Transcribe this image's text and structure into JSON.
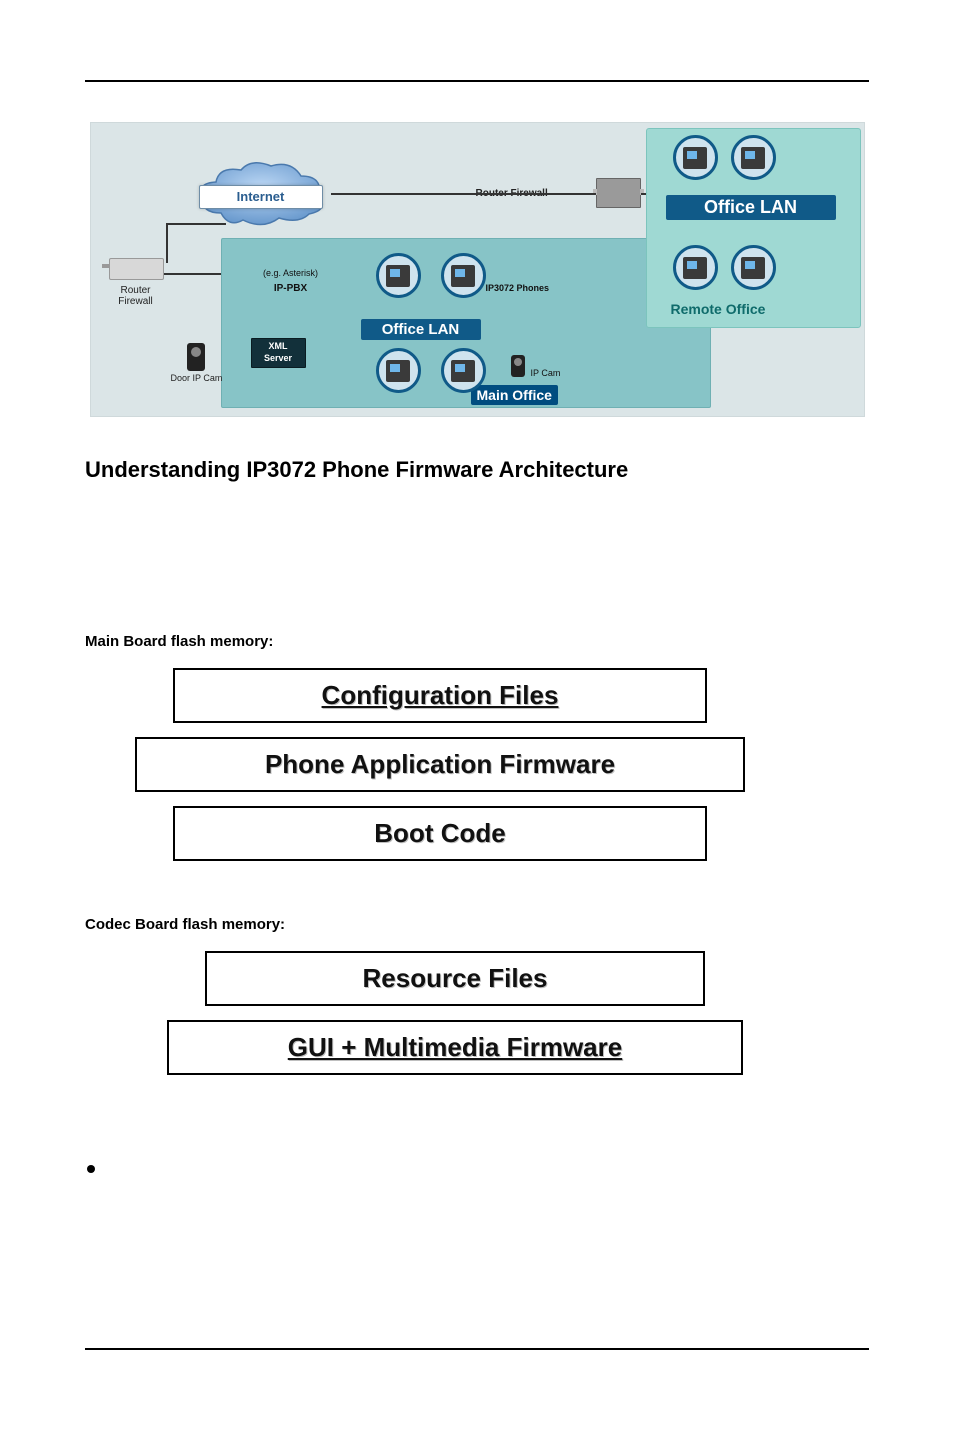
{
  "diagram": {
    "internet": "Internet",
    "routerFirewallTop": "Router Firewall",
    "routerFirewallSide": "Router\nFirewall",
    "ippbxNote": "(e.g. Asterisk)",
    "ippbx": "IP-PBX",
    "xmlServer": "XML\nServer",
    "doorCam": "Door IP Cam",
    "officeLanMain": "Office LAN",
    "ip3072Phones": "IP3072 Phones",
    "ipCam": "IP Cam",
    "mainOffice": "Main Office",
    "officeLanRemote": "Office LAN",
    "remoteOffice": "Remote Office"
  },
  "heading": "Understanding IP3072 Phone Firmware Architecture",
  "mainBoard": {
    "title": "Main Board flash memory:",
    "layers": [
      "Configuration Files",
      "Phone Application Firmware",
      "Boot Code"
    ]
  },
  "codecBoard": {
    "title": "Codec Board flash memory:",
    "layers": [
      "Resource Files",
      "GUI + Multimedia Firmware"
    ]
  }
}
